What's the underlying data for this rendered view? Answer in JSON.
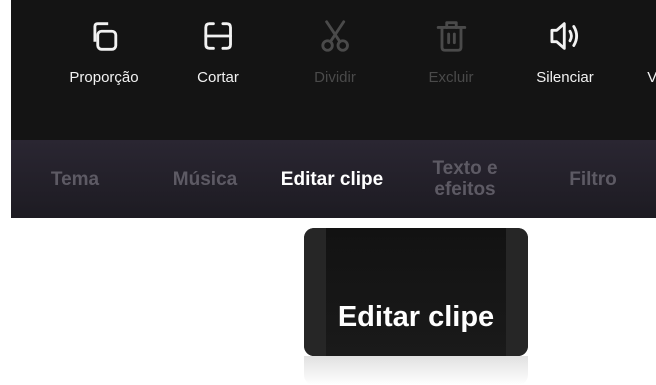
{
  "toolbar": {
    "tools": [
      {
        "label": "Proporção",
        "icon": "aspect-ratio-icon",
        "enabled": true
      },
      {
        "label": "Cortar",
        "icon": "trim-icon",
        "enabled": true
      },
      {
        "label": "Dividir",
        "icon": "scissors-icon",
        "enabled": false
      },
      {
        "label": "Excluir",
        "icon": "trash-icon",
        "enabled": false
      },
      {
        "label": "Silenciar",
        "icon": "speaker-icon",
        "enabled": true
      },
      {
        "label": "Ve",
        "icon": "",
        "enabled": true
      }
    ]
  },
  "tabs": [
    {
      "label": "Tema",
      "active": false
    },
    {
      "label": "Música",
      "active": false
    },
    {
      "label": "Editar clipe",
      "active": true
    },
    {
      "label": "Texto e efeitos",
      "active": false
    },
    {
      "label": "Filtro",
      "active": false
    }
  ],
  "zoom": {
    "label": "Editar clipe"
  },
  "colors": {
    "highlight": "#a995c8",
    "background": "#161616",
    "tab_inactive": "#5d5a64"
  }
}
